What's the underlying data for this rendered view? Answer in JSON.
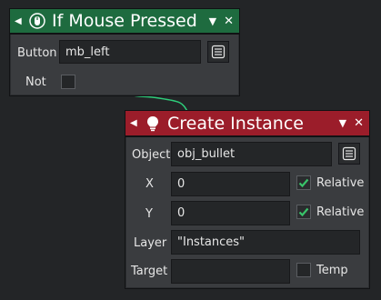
{
  "colors": {
    "background": "#232527",
    "node_body": "#3a3c3f",
    "green_header": "#1e6b3f",
    "red_header": "#9b1d2a",
    "wire": "#2ecc7a",
    "check": "#39c46a"
  },
  "mouse_node": {
    "title": "If Mouse Pressed",
    "icon": "mouse-icon",
    "fields": {
      "button_label": "Button",
      "button_value": "mb_left",
      "not_label": "Not",
      "not_checked": false
    }
  },
  "instance_node": {
    "title": "Create Instance",
    "icon": "lightbulb-icon",
    "fields": {
      "object_label": "Object",
      "object_value": "obj_bullet",
      "x_label": "X",
      "x_value": "0",
      "x_relative_label": "Relative",
      "x_relative_checked": true,
      "y_label": "Y",
      "y_value": "0",
      "y_relative_label": "Relative",
      "y_relative_checked": true,
      "layer_label": "Layer",
      "layer_value": "\"Instances\"",
      "target_label": "Target",
      "target_value": "",
      "temp_label": "Temp",
      "temp_checked": false
    }
  }
}
